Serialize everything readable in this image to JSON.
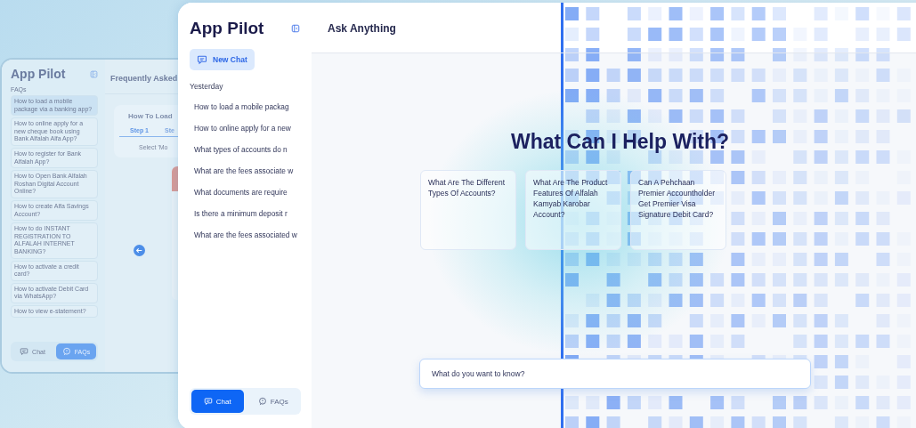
{
  "back_window": {
    "title": "App Pilot",
    "section_label": "FAQs",
    "faqs": [
      {
        "label": "How to load a mobile package via a banking app?",
        "selected": true
      },
      {
        "label": "How to online apply for a new cheque book using Bank Alfalah Alfa App?",
        "selected": false
      },
      {
        "label": "How to register for Bank Alfalah App?",
        "selected": false
      },
      {
        "label": "How to Open Bank Alfalah Roshan Digital Account Online?",
        "selected": false
      },
      {
        "label": "How to create Alfa Savings Account?",
        "selected": false
      },
      {
        "label": "How to do INSTANT REGISTRATION TO ALFALAH INTERNET BANKING?",
        "selected": false
      },
      {
        "label": "How to activate a credit card?",
        "selected": false
      },
      {
        "label": "How to activate Debit Card via WhatsApp?",
        "selected": false
      },
      {
        "label": "How to view e-statement?",
        "selected": false
      }
    ],
    "header": "Frequently Asked",
    "card_title": "How To Load",
    "steps": [
      {
        "label": "Step 1",
        "selected": true
      },
      {
        "label": "Ste",
        "selected": false
      }
    ],
    "step_text": "Select 'Mo",
    "nav_tabs": [
      {
        "label": "Chat",
        "kind": "chat",
        "selected": false
      },
      {
        "label": "FAQs",
        "kind": "faq",
        "selected": true
      }
    ]
  },
  "front_window": {
    "title": "App Pilot",
    "new_chat": "New Chat",
    "history_label": "Yesterday",
    "history": [
      "How to load a mobile packag",
      "How to online apply for a new",
      "What types of accounts do n",
      "What are the fees associate w",
      "What documents are require",
      "Is there a minimum deposit r",
      "What are the fees associated w"
    ],
    "nav_tabs": [
      {
        "label": "Chat",
        "kind": "chat",
        "selected": true
      },
      {
        "label": "FAQs",
        "kind": "faq",
        "selected": false
      }
    ],
    "header": "Ask Anything",
    "heading": "What Can I Help With?",
    "suggestions": [
      "What Are The Different Types Of Accounts?",
      "What Are The Product Features Of Alfalah Kamyab Karobar Account?",
      "Can A Pehchaan Premier Accountholder Get Premier Visa Signature Debit Card?"
    ],
    "input": {
      "placeholder": "What do you want to know?"
    }
  }
}
